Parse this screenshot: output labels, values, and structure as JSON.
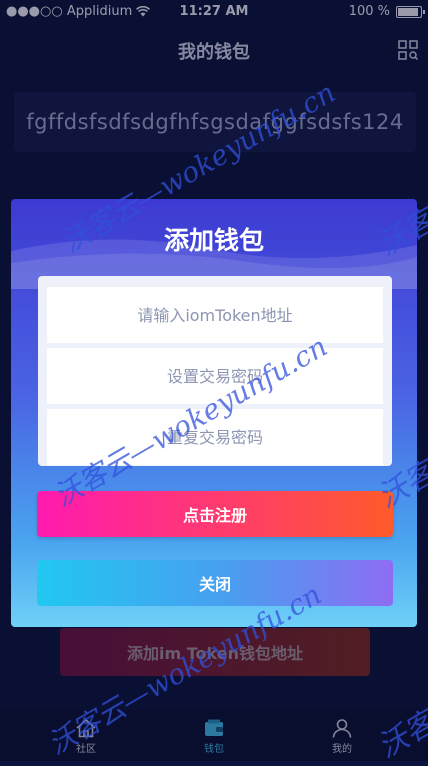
{
  "status_bar": {
    "carrier": "●●●○○ Applidium",
    "time": "11:27 AM",
    "battery_text": "100 %",
    "battery_level": 1.0
  },
  "nav": {
    "title": "我的钱包",
    "scan_icon": "qr-scan-icon"
  },
  "wallet_address": "fgffdsfsdfsdgfhfsgsdafggfsdsfs124",
  "bottom_button_label": "添加im Token钱包地址",
  "tabs": [
    {
      "label": "社区",
      "icon": "home-icon"
    },
    {
      "label": "钱包",
      "icon": "wallet-icon"
    },
    {
      "label": "我的",
      "icon": "person-icon"
    }
  ],
  "modal": {
    "title": "添加钱包",
    "fields": [
      {
        "placeholder": "请输入iomToken地址"
      },
      {
        "placeholder": "设置交易密码"
      },
      {
        "placeholder": "重复交易密码"
      }
    ],
    "register_label": "点击注册",
    "close_label": "关闭"
  },
  "watermark": {
    "main": "沃客云—wokeyunfu.cn",
    "side": "沃客"
  },
  "colors": {
    "background": "#0d1440",
    "accent_tab": "#3fb6e8",
    "register_gradient_start": "#ff1ab0",
    "register_gradient_end": "#ff5a2a",
    "close_gradient_start": "#21c8f0",
    "close_gradient_end": "#8f6cf2"
  }
}
